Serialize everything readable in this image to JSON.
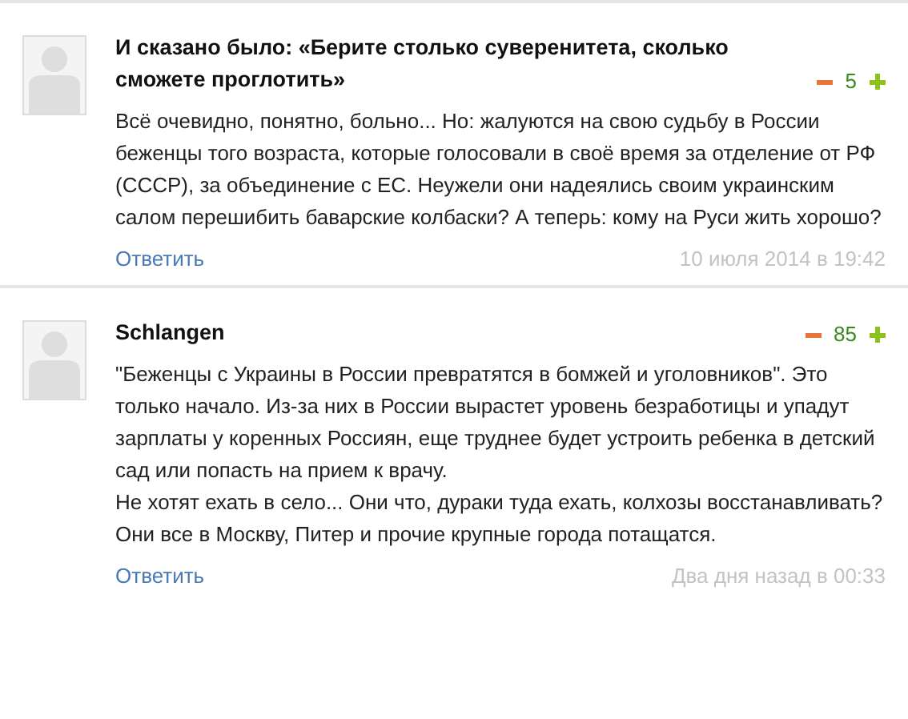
{
  "comments": [
    {
      "author": "И сказано было: «Берите столько суверенитета, сколько сможете проглотить»",
      "score": "5",
      "paragraphs": [
        "Всё очевидно, понятно, больно... Но: жалуются на свою судьбу в России беженцы того возраста, которые голосовали в своё время за отделение от РФ (СССР), за объединение с ЕС. Неужели они надеялись своим украинским салом перешибить баварские колбаски? А теперь: кому на Руси жить хорошо?"
      ],
      "reply": "Ответить",
      "date": "10 июля 2014 в 19:42"
    },
    {
      "author": "Schlangen",
      "score": "85",
      "paragraphs": [
        "\"Беженцы с Украины в России превратятся в бомжей и уголовников\". Это только начало. Из-за них в России вырастет уровень безработицы и упадут зарплаты у коренных Россиян, еще труднее будет устроить ребенка в детский сад или попасть на прием к врачу.",
        "Не хотят ехать в село... Они что, дураки туда ехать, колхозы восстанавливать? Они все в Москву, Питер и прочие крупные города потащатся."
      ],
      "reply": "Ответить",
      "date": "Два дня назад в 00:33"
    }
  ]
}
